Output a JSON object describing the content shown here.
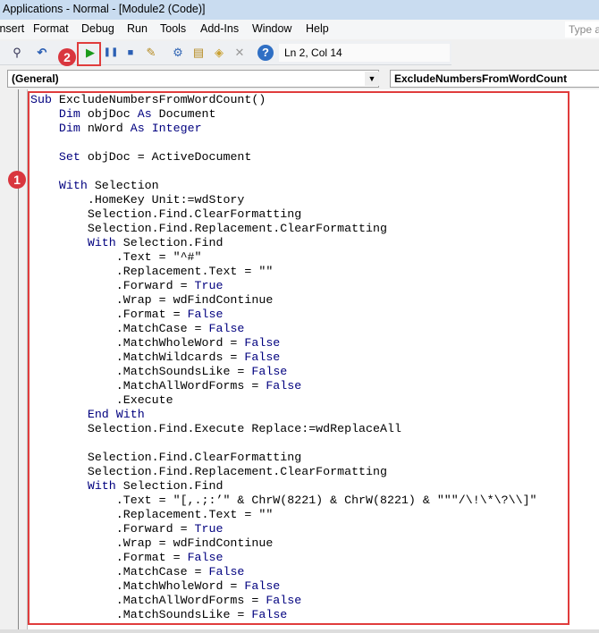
{
  "window": {
    "title": "Applications - Normal - [Module2 (Code)]"
  },
  "menu": [
    "Insert",
    "Format",
    "Debug",
    "Run",
    "Tools",
    "Add-Ins",
    "Window",
    "Help"
  ],
  "help_search_placeholder": "Type a",
  "toolbar": {
    "status": "Ln 2, Col 14",
    "icons": [
      "find-icon",
      "undo-icon",
      "run-icon",
      "pause-icon",
      "stop-icon",
      "design-mode-icon",
      "project-explorer-icon",
      "properties-icon",
      "object-browser-icon",
      "toolbox-icon",
      "help-icon"
    ]
  },
  "annotations": {
    "one": "1",
    "two": "2",
    "highlight_color": "#e03c3c"
  },
  "object_combo": "(General)",
  "procedure_combo": "ExcludeNumbersFromWordCount",
  "colors": {
    "keyword": "#00007f"
  },
  "code": [
    [
      [
        "k",
        "Sub"
      ],
      [
        "t",
        " ExcludeNumbersFromWordCount()"
      ]
    ],
    [
      [
        "t",
        "    "
      ],
      [
        "k",
        "Dim"
      ],
      [
        "t",
        " objDoc "
      ],
      [
        "k",
        "As"
      ],
      [
        "t",
        " Document"
      ]
    ],
    [
      [
        "t",
        "    "
      ],
      [
        "k",
        "Dim"
      ],
      [
        "t",
        " nWord "
      ],
      [
        "k",
        "As"
      ],
      [
        "t",
        " "
      ],
      [
        "k",
        "Integer"
      ]
    ],
    [
      [
        "t",
        ""
      ]
    ],
    [
      [
        "t",
        "    "
      ],
      [
        "k",
        "Set"
      ],
      [
        "t",
        " objDoc = ActiveDocument"
      ]
    ],
    [
      [
        "t",
        ""
      ]
    ],
    [
      [
        "t",
        "    "
      ],
      [
        "k",
        "With"
      ],
      [
        "t",
        " Selection"
      ]
    ],
    [
      [
        "t",
        "        .HomeKey Unit:=wdStory"
      ]
    ],
    [
      [
        "t",
        "        Selection.Find.ClearFormatting"
      ]
    ],
    [
      [
        "t",
        "        Selection.Find.Replacement.ClearFormatting"
      ]
    ],
    [
      [
        "t",
        "        "
      ],
      [
        "k",
        "With"
      ],
      [
        "t",
        " Selection.Find"
      ]
    ],
    [
      [
        "t",
        "            .Text = \"^#\""
      ]
    ],
    [
      [
        "t",
        "            .Replacement.Text = \"\""
      ]
    ],
    [
      [
        "t",
        "            .Forward = "
      ],
      [
        "k",
        "True"
      ]
    ],
    [
      [
        "t",
        "            .Wrap = wdFindContinue"
      ]
    ],
    [
      [
        "t",
        "            .Format = "
      ],
      [
        "k",
        "False"
      ]
    ],
    [
      [
        "t",
        "            .MatchCase = "
      ],
      [
        "k",
        "False"
      ]
    ],
    [
      [
        "t",
        "            .MatchWholeWord = "
      ],
      [
        "k",
        "False"
      ]
    ],
    [
      [
        "t",
        "            .MatchWildcards = "
      ],
      [
        "k",
        "False"
      ]
    ],
    [
      [
        "t",
        "            .MatchSoundsLike = "
      ],
      [
        "k",
        "False"
      ]
    ],
    [
      [
        "t",
        "            .MatchAllWordForms = "
      ],
      [
        "k",
        "False"
      ]
    ],
    [
      [
        "t",
        "            .Execute"
      ]
    ],
    [
      [
        "t",
        "        "
      ],
      [
        "k",
        "End With"
      ]
    ],
    [
      [
        "t",
        "        Selection.Find.Execute Replace:=wdReplaceAll"
      ]
    ],
    [
      [
        "t",
        ""
      ]
    ],
    [
      [
        "t",
        "        Selection.Find.ClearFormatting"
      ]
    ],
    [
      [
        "t",
        "        Selection.Find.Replacement.ClearFormatting"
      ]
    ],
    [
      [
        "t",
        "        "
      ],
      [
        "k",
        "With"
      ],
      [
        "t",
        " Selection.Find"
      ]
    ],
    [
      [
        "t",
        "            .Text = \"[,.;:’\" & ChrW(8221) & ChrW(8221) & \"\"\"/\\!\\*\\?\\\\]\""
      ]
    ],
    [
      [
        "t",
        "            .Replacement.Text = \"\""
      ]
    ],
    [
      [
        "t",
        "            .Forward = "
      ],
      [
        "k",
        "True"
      ]
    ],
    [
      [
        "t",
        "            .Wrap = wdFindContinue"
      ]
    ],
    [
      [
        "t",
        "            .Format = "
      ],
      [
        "k",
        "False"
      ]
    ],
    [
      [
        "t",
        "            .MatchCase = "
      ],
      [
        "k",
        "False"
      ]
    ],
    [
      [
        "t",
        "            .MatchWholeWord = "
      ],
      [
        "k",
        "False"
      ]
    ],
    [
      [
        "t",
        "            .MatchAllWordForms = "
      ],
      [
        "k",
        "False"
      ]
    ],
    [
      [
        "t",
        "            .MatchSoundsLike = "
      ],
      [
        "k",
        "False"
      ]
    ]
  ]
}
